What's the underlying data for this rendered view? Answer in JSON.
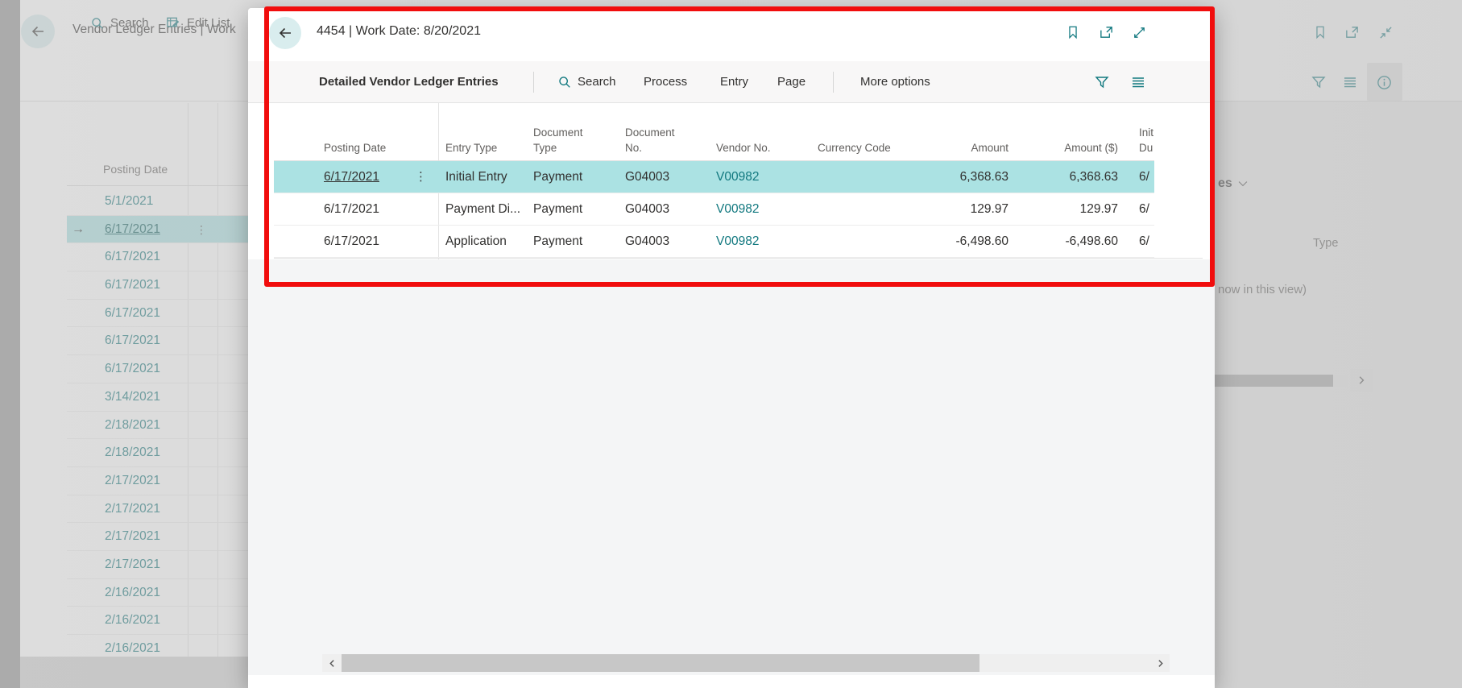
{
  "colors": {
    "accent": "#11787f",
    "selection": "#abe2e3",
    "annotation_red": "#f10d0d",
    "back_circle": "#d9edee"
  },
  "annotation": {
    "type": "red-highlight-box"
  },
  "modal": {
    "title": "4454 | Work Date: 8/20/2021",
    "header_icons": [
      "back-arrow",
      "bookmark",
      "open-in-new-window",
      "expand"
    ],
    "ribbon": {
      "caption": "Detailed Vendor Ledger Entries",
      "menu": [
        "Search",
        "Process",
        "Entry",
        "Page"
      ],
      "more_options": "More options",
      "icons": [
        "filter",
        "switch-view"
      ]
    },
    "table": {
      "columns": [
        {
          "id": "posting_date",
          "lines": [
            "Posting Date"
          ]
        },
        {
          "id": "entry_type",
          "lines": [
            "Entry Type"
          ]
        },
        {
          "id": "document_type",
          "lines": [
            "Document",
            "Type"
          ]
        },
        {
          "id": "document_no",
          "lines": [
            "Document",
            "No."
          ]
        },
        {
          "id": "vendor_no",
          "lines": [
            "Vendor No."
          ]
        },
        {
          "id": "currency_code",
          "lines": [
            "Currency Code"
          ]
        },
        {
          "id": "amount",
          "lines": [
            "Amount"
          ]
        },
        {
          "id": "amount_usd",
          "lines": [
            "Amount ($)"
          ]
        },
        {
          "id": "init_due",
          "lines": [
            "Init",
            "Du"
          ]
        }
      ],
      "rows": [
        {
          "posting_date": "6/17/2021",
          "entry_type": "Initial Entry",
          "document_type": "Payment",
          "document_no": "G04003",
          "vendor_no": "V00982",
          "currency_code": "",
          "amount": "6,368.63",
          "amount_usd": "6,368.63",
          "init_due": "6/",
          "selected": true
        },
        {
          "posting_date": "6/17/2021",
          "entry_type": "Payment Di...",
          "document_type": "Payment",
          "document_no": "G04003",
          "vendor_no": "V00982",
          "currency_code": "",
          "amount": "129.97",
          "amount_usd": "129.97",
          "init_due": "6/",
          "selected": false
        },
        {
          "posting_date": "6/17/2021",
          "entry_type": "Application",
          "document_type": "Payment",
          "document_no": "G04003",
          "vendor_no": "V00982",
          "currency_code": "",
          "amount": "-6,498.60",
          "amount_usd": "-6,498.60",
          "init_due": "6/",
          "selected": false
        }
      ]
    },
    "scrollbar": {
      "left_arrow": "chevron-left",
      "right_arrow": "chevron-right"
    }
  },
  "background": {
    "title": "Vendor Ledger Entries | Work",
    "ribbon": {
      "search": "Search",
      "edit_list": "Edit List"
    },
    "header_icons": [
      "bookmark",
      "open-in-new-window",
      "collapse"
    ],
    "panel_icons": [
      "filter",
      "switch-view",
      "info"
    ],
    "list": {
      "column_label": "Posting Date",
      "rows": [
        {
          "date": "5/1/2021",
          "selected": false
        },
        {
          "date": "6/17/2021",
          "selected": true
        },
        {
          "date": "6/17/2021",
          "selected": false
        },
        {
          "date": "6/17/2021",
          "selected": false
        },
        {
          "date": "6/17/2021",
          "selected": false
        },
        {
          "date": "6/17/2021",
          "selected": false
        },
        {
          "date": "6/17/2021",
          "selected": false
        },
        {
          "date": "3/14/2021",
          "selected": false
        },
        {
          "date": "2/18/2021",
          "selected": false
        },
        {
          "date": "2/18/2021",
          "selected": false
        },
        {
          "date": "2/17/2021",
          "selected": false
        },
        {
          "date": "2/17/2021",
          "selected": false
        },
        {
          "date": "2/17/2021",
          "selected": false
        },
        {
          "date": "2/17/2021",
          "selected": false
        },
        {
          "date": "2/16/2021",
          "selected": false
        },
        {
          "date": "2/16/2021",
          "selected": false
        },
        {
          "date": "2/16/2021",
          "selected": false
        }
      ]
    },
    "factbox": {
      "heading_truncated": "es",
      "column_label": "Type",
      "empty_message_truncated": "now in this view)"
    }
  }
}
